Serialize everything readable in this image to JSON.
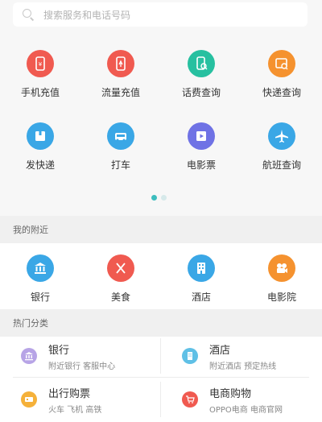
{
  "search": {
    "placeholder": "搜索服务和电话号码"
  },
  "services_row1": [
    {
      "label": "手机充值",
      "icon": "phone-recharge-icon",
      "color": "#f05a50"
    },
    {
      "label": "流量充值",
      "icon": "data-recharge-icon",
      "color": "#f05a50"
    },
    {
      "label": "话费查询",
      "icon": "bill-query-icon",
      "color": "#27c0a0"
    },
    {
      "label": "快递查询",
      "icon": "express-query-icon",
      "color": "#f5922f"
    }
  ],
  "services_row2": [
    {
      "label": "发快递",
      "icon": "send-package-icon",
      "color": "#3aa7e6"
    },
    {
      "label": "打车",
      "icon": "taxi-icon",
      "color": "#3aa7e6"
    },
    {
      "label": "电影票",
      "icon": "movie-ticket-icon",
      "color": "#6f72e5"
    },
    {
      "label": "航班查询",
      "icon": "flight-icon",
      "color": "#3aa7e6"
    }
  ],
  "pagination": {
    "pages": 2,
    "current": 1,
    "active_color": "#3cbdbe"
  },
  "nearby": {
    "title": "我的附近",
    "items": [
      {
        "label": "银行",
        "icon": "bank-icon",
        "color": "#3aa7e6"
      },
      {
        "label": "美食",
        "icon": "food-icon",
        "color": "#f05a50"
      },
      {
        "label": "酒店",
        "icon": "hotel-icon",
        "color": "#3aa7e6"
      },
      {
        "label": "电影院",
        "icon": "cinema-icon",
        "color": "#f5922f"
      }
    ]
  },
  "hot": {
    "title": "热门分类",
    "items": [
      {
        "title": "银行",
        "sub": "附近银行 客服中心",
        "icon": "bank-icon",
        "color": "#b7a4e6"
      },
      {
        "title": "酒店",
        "sub": "附近酒店 预定热线",
        "icon": "hotel-icon",
        "color": "#5fc0e6"
      },
      {
        "title": "出行购票",
        "sub": "火车 飞机 高铁",
        "icon": "ticket-icon",
        "color": "#f5b13a"
      },
      {
        "title": "电商购物",
        "sub": "OPPO电商 电商官网",
        "icon": "shopping-cart-icon",
        "color": "#f05a50"
      }
    ]
  }
}
